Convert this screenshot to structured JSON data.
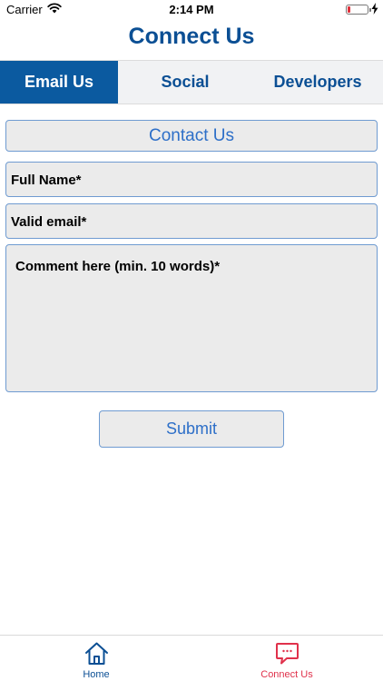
{
  "status_bar": {
    "carrier": "Carrier",
    "time": "2:14 PM"
  },
  "nav": {
    "title": "Connect Us"
  },
  "tabs": [
    {
      "label": "Email Us",
      "active": true
    },
    {
      "label": "Social",
      "active": false
    },
    {
      "label": "Developers",
      "active": false
    }
  ],
  "form": {
    "header": "Contact Us",
    "full_name_placeholder": "Full Name*",
    "email_placeholder": "Valid email*",
    "comment_placeholder": "Comment here (min. 10 words)*",
    "submit_label": "Submit"
  },
  "tab_bar": [
    {
      "label": "Home",
      "icon": "home-icon",
      "color": "#0b4f94"
    },
    {
      "label": "Connect Us",
      "icon": "chat-bubble-icon",
      "color": "#e0314b",
      "selected": true
    }
  ],
  "colors": {
    "brand": "#0b4f94",
    "active_tab": "#0b5aa0",
    "field_border": "#6f9bd1",
    "accent_text": "#2d6fc8",
    "battery_low": "#e0313b"
  }
}
